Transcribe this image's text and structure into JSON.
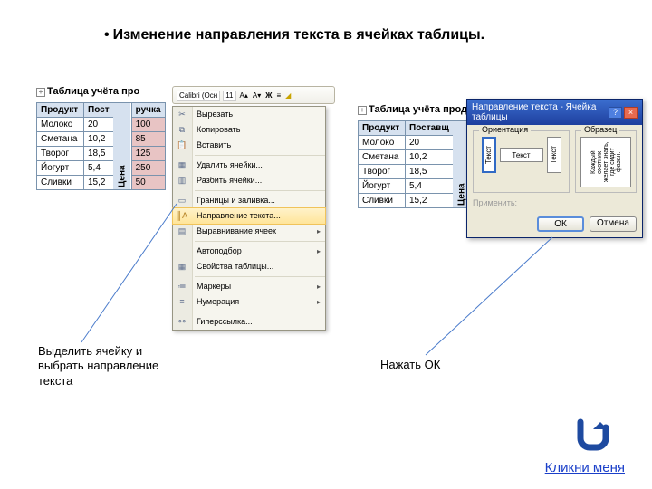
{
  "title": "Изменение направления текста в ячейках таблицы.",
  "table_title": "Таблица учёта прода",
  "table_title_full": "Таблица учёта про",
  "headers": {
    "product": "Продукт",
    "supplier": "Пост",
    "supplier2": "Поставщ",
    "price": "Цена",
    "rev": "ручка"
  },
  "rows": [
    {
      "p": "Молоко",
      "q": "20",
      "v": "100"
    },
    {
      "p": "Сметана",
      "q": "10,2",
      "v": "85"
    },
    {
      "p": "Творог",
      "q": "18,5",
      "v": "125"
    },
    {
      "p": "Йогурт",
      "q": "5,4",
      "v": "250"
    },
    {
      "p": "Сливки",
      "q": "15,2",
      "v": "50"
    }
  ],
  "minitb": {
    "font": "Calibri (Осн",
    "size": "11"
  },
  "ctx": {
    "cut": "Вырезать",
    "copy": "Копировать",
    "paste": "Вставить",
    "delcells": "Удалить ячейки...",
    "split": "Разбить ячейки...",
    "borders": "Границы и заливка...",
    "direction": "Направление текста...",
    "align": "Выравнивание ячеек",
    "autofit": "Автоподбор",
    "props": "Свойства таблицы...",
    "bullets": "Маркеры",
    "numbering": "Нумерация",
    "link": "Гиперссылка..."
  },
  "dialog": {
    "title": "Направление текста - Ячейка таблицы",
    "orientation": "Ориентация",
    "sample": "Образец",
    "text": "Текст",
    "sample_text": "Каждый охотник желает знать, где сидит фазан.",
    "apply": "Применить:",
    "ok": "ОК",
    "cancel": "Отмена"
  },
  "captions": {
    "left": "Выделить ячейку и выбрать направление текста",
    "right": "Нажать  ОК"
  },
  "link": "Кликни меня"
}
